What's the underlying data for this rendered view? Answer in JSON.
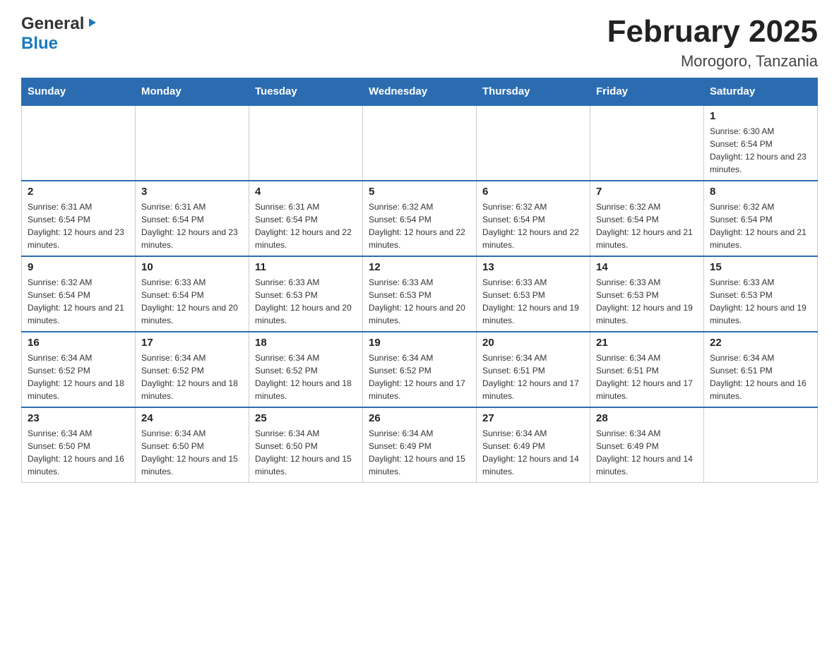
{
  "header": {
    "logo_general": "General",
    "logo_blue": "Blue",
    "title": "February 2025",
    "subtitle": "Morogoro, Tanzania"
  },
  "weekdays": [
    "Sunday",
    "Monday",
    "Tuesday",
    "Wednesday",
    "Thursday",
    "Friday",
    "Saturday"
  ],
  "weeks": [
    [
      {
        "day": "",
        "sunrise": "",
        "sunset": "",
        "daylight": ""
      },
      {
        "day": "",
        "sunrise": "",
        "sunset": "",
        "daylight": ""
      },
      {
        "day": "",
        "sunrise": "",
        "sunset": "",
        "daylight": ""
      },
      {
        "day": "",
        "sunrise": "",
        "sunset": "",
        "daylight": ""
      },
      {
        "day": "",
        "sunrise": "",
        "sunset": "",
        "daylight": ""
      },
      {
        "day": "",
        "sunrise": "",
        "sunset": "",
        "daylight": ""
      },
      {
        "day": "1",
        "sunrise": "Sunrise: 6:30 AM",
        "sunset": "Sunset: 6:54 PM",
        "daylight": "Daylight: 12 hours and 23 minutes."
      }
    ],
    [
      {
        "day": "2",
        "sunrise": "Sunrise: 6:31 AM",
        "sunset": "Sunset: 6:54 PM",
        "daylight": "Daylight: 12 hours and 23 minutes."
      },
      {
        "day": "3",
        "sunrise": "Sunrise: 6:31 AM",
        "sunset": "Sunset: 6:54 PM",
        "daylight": "Daylight: 12 hours and 23 minutes."
      },
      {
        "day": "4",
        "sunrise": "Sunrise: 6:31 AM",
        "sunset": "Sunset: 6:54 PM",
        "daylight": "Daylight: 12 hours and 22 minutes."
      },
      {
        "day": "5",
        "sunrise": "Sunrise: 6:32 AM",
        "sunset": "Sunset: 6:54 PM",
        "daylight": "Daylight: 12 hours and 22 minutes."
      },
      {
        "day": "6",
        "sunrise": "Sunrise: 6:32 AM",
        "sunset": "Sunset: 6:54 PM",
        "daylight": "Daylight: 12 hours and 22 minutes."
      },
      {
        "day": "7",
        "sunrise": "Sunrise: 6:32 AM",
        "sunset": "Sunset: 6:54 PM",
        "daylight": "Daylight: 12 hours and 21 minutes."
      },
      {
        "day": "8",
        "sunrise": "Sunrise: 6:32 AM",
        "sunset": "Sunset: 6:54 PM",
        "daylight": "Daylight: 12 hours and 21 minutes."
      }
    ],
    [
      {
        "day": "9",
        "sunrise": "Sunrise: 6:32 AM",
        "sunset": "Sunset: 6:54 PM",
        "daylight": "Daylight: 12 hours and 21 minutes."
      },
      {
        "day": "10",
        "sunrise": "Sunrise: 6:33 AM",
        "sunset": "Sunset: 6:54 PM",
        "daylight": "Daylight: 12 hours and 20 minutes."
      },
      {
        "day": "11",
        "sunrise": "Sunrise: 6:33 AM",
        "sunset": "Sunset: 6:53 PM",
        "daylight": "Daylight: 12 hours and 20 minutes."
      },
      {
        "day": "12",
        "sunrise": "Sunrise: 6:33 AM",
        "sunset": "Sunset: 6:53 PM",
        "daylight": "Daylight: 12 hours and 20 minutes."
      },
      {
        "day": "13",
        "sunrise": "Sunrise: 6:33 AM",
        "sunset": "Sunset: 6:53 PM",
        "daylight": "Daylight: 12 hours and 19 minutes."
      },
      {
        "day": "14",
        "sunrise": "Sunrise: 6:33 AM",
        "sunset": "Sunset: 6:53 PM",
        "daylight": "Daylight: 12 hours and 19 minutes."
      },
      {
        "day": "15",
        "sunrise": "Sunrise: 6:33 AM",
        "sunset": "Sunset: 6:53 PM",
        "daylight": "Daylight: 12 hours and 19 minutes."
      }
    ],
    [
      {
        "day": "16",
        "sunrise": "Sunrise: 6:34 AM",
        "sunset": "Sunset: 6:52 PM",
        "daylight": "Daylight: 12 hours and 18 minutes."
      },
      {
        "day": "17",
        "sunrise": "Sunrise: 6:34 AM",
        "sunset": "Sunset: 6:52 PM",
        "daylight": "Daylight: 12 hours and 18 minutes."
      },
      {
        "day": "18",
        "sunrise": "Sunrise: 6:34 AM",
        "sunset": "Sunset: 6:52 PM",
        "daylight": "Daylight: 12 hours and 18 minutes."
      },
      {
        "day": "19",
        "sunrise": "Sunrise: 6:34 AM",
        "sunset": "Sunset: 6:52 PM",
        "daylight": "Daylight: 12 hours and 17 minutes."
      },
      {
        "day": "20",
        "sunrise": "Sunrise: 6:34 AM",
        "sunset": "Sunset: 6:51 PM",
        "daylight": "Daylight: 12 hours and 17 minutes."
      },
      {
        "day": "21",
        "sunrise": "Sunrise: 6:34 AM",
        "sunset": "Sunset: 6:51 PM",
        "daylight": "Daylight: 12 hours and 17 minutes."
      },
      {
        "day": "22",
        "sunrise": "Sunrise: 6:34 AM",
        "sunset": "Sunset: 6:51 PM",
        "daylight": "Daylight: 12 hours and 16 minutes."
      }
    ],
    [
      {
        "day": "23",
        "sunrise": "Sunrise: 6:34 AM",
        "sunset": "Sunset: 6:50 PM",
        "daylight": "Daylight: 12 hours and 16 minutes."
      },
      {
        "day": "24",
        "sunrise": "Sunrise: 6:34 AM",
        "sunset": "Sunset: 6:50 PM",
        "daylight": "Daylight: 12 hours and 15 minutes."
      },
      {
        "day": "25",
        "sunrise": "Sunrise: 6:34 AM",
        "sunset": "Sunset: 6:50 PM",
        "daylight": "Daylight: 12 hours and 15 minutes."
      },
      {
        "day": "26",
        "sunrise": "Sunrise: 6:34 AM",
        "sunset": "Sunset: 6:49 PM",
        "daylight": "Daylight: 12 hours and 15 minutes."
      },
      {
        "day": "27",
        "sunrise": "Sunrise: 6:34 AM",
        "sunset": "Sunset: 6:49 PM",
        "daylight": "Daylight: 12 hours and 14 minutes."
      },
      {
        "day": "28",
        "sunrise": "Sunrise: 6:34 AM",
        "sunset": "Sunset: 6:49 PM",
        "daylight": "Daylight: 12 hours and 14 minutes."
      },
      {
        "day": "",
        "sunrise": "",
        "sunset": "",
        "daylight": ""
      }
    ]
  ]
}
